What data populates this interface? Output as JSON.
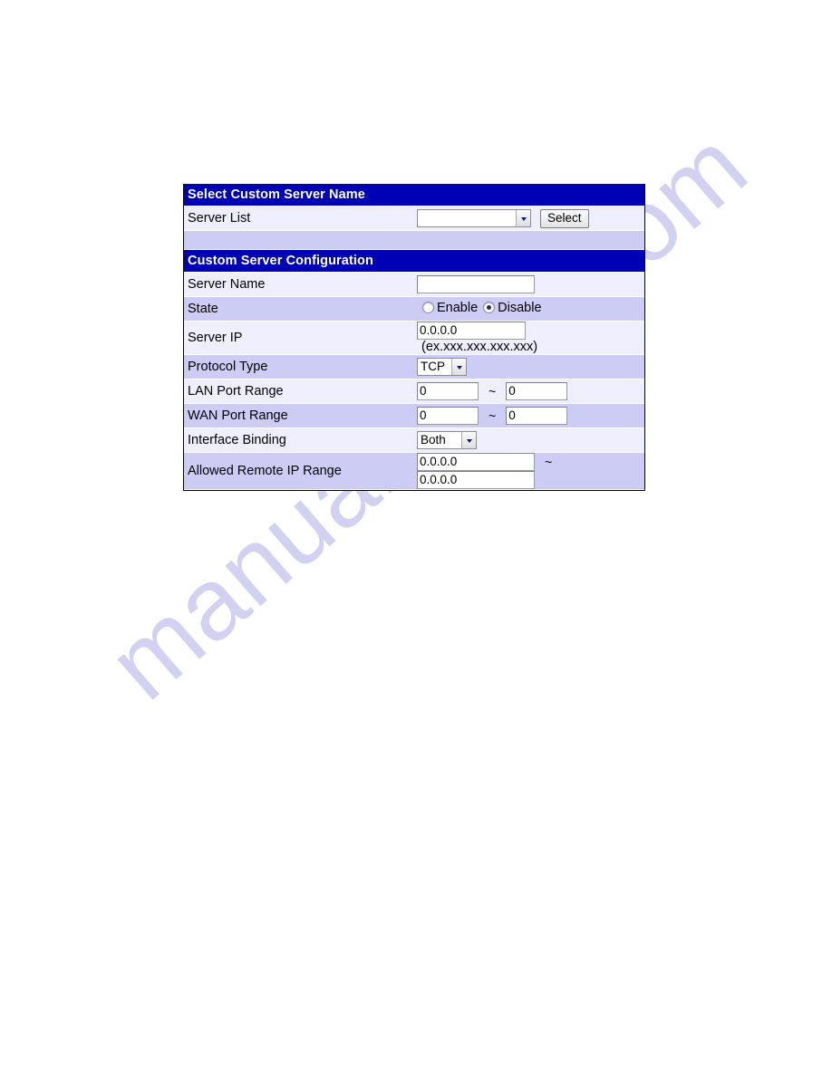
{
  "watermark": {
    "text": "manualshive.com"
  },
  "colors": {
    "header_bar": "#0000B4",
    "header_text": "#FFFFFF",
    "row_light": "#EEEEFC",
    "row_dark": "#CCCCF5",
    "border": "#000000"
  },
  "panel": {
    "sections": [
      {
        "title": "Select Custom Server Name",
        "rows": [
          {
            "label": "Server List",
            "control": "select-with-button",
            "select_value": "",
            "button_label": "Select"
          }
        ]
      },
      {
        "title": "Custom Server Configuration",
        "rows": [
          {
            "label": "Server Name",
            "control": "text",
            "value": ""
          },
          {
            "label": "State",
            "control": "radio",
            "options": [
              "Enable",
              "Disable"
            ],
            "selected": "Disable"
          },
          {
            "label": "Server IP",
            "control": "text-hint",
            "value": "0.0.0.0",
            "hint": "(ex.xxx.xxx.xxx.xxx)"
          },
          {
            "label": "Protocol Type",
            "control": "dropdown",
            "value": "TCP"
          },
          {
            "label": "LAN Port Range",
            "control": "range-port",
            "from": "0",
            "to": "0",
            "separator": "~"
          },
          {
            "label": "WAN Port Range",
            "control": "range-port",
            "from": "0",
            "to": "0",
            "separator": "~"
          },
          {
            "label": "Interface Binding",
            "control": "dropdown",
            "value": "Both"
          },
          {
            "label": "Allowed Remote IP Range",
            "control": "range-ip",
            "from": "0.0.0.0",
            "to": "0.0.0.0",
            "separator": "~"
          }
        ]
      }
    ]
  }
}
